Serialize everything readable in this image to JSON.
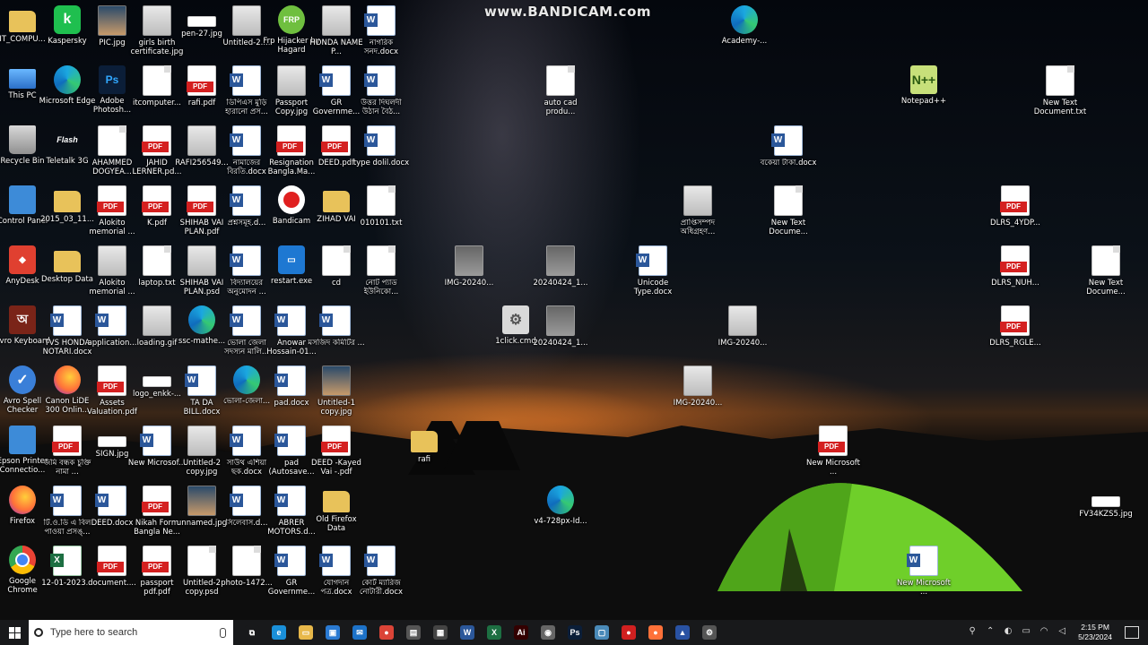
{
  "watermark": "www.BANDICAM.com",
  "desktop": {
    "icons": [
      {
        "label": "IT_COMPU...",
        "type": "folder"
      },
      {
        "label": "Kaspersky",
        "type": "green",
        "glyph": "k"
      },
      {
        "label": "PIC.jpg",
        "type": "photo"
      },
      {
        "label": "girls birth certificate.jpg",
        "type": "img"
      },
      {
        "label": "pen-27.jpg",
        "type": "white"
      },
      {
        "label": "Untitled-2....",
        "type": "img"
      },
      {
        "label": "Frp Hijacker by Hagard",
        "type": "frp",
        "glyph": "FRP"
      },
      {
        "label": "HONDA NAME P...",
        "type": "img"
      },
      {
        "label": "নাগরিক সনদ.docx",
        "type": "word"
      },
      {
        "label": "Academy-...",
        "type": "edge"
      },
      {
        "label": "This PC",
        "type": "pc"
      },
      {
        "label": "Microsoft Edge",
        "type": "edge"
      },
      {
        "label": "Adobe Photosh...",
        "type": "ps",
        "glyph": "Ps"
      },
      {
        "label": "itcomputer...",
        "type": "doc"
      },
      {
        "label": "rafi.pdf",
        "type": "pdf"
      },
      {
        "label": "ডিপিএস মুড়ি হারানো প্রস...",
        "type": "word"
      },
      {
        "label": "Passport Copy.jpg",
        "type": "img"
      },
      {
        "label": "GR Governme...",
        "type": "word"
      },
      {
        "label": "উত্তর দিঘলদী উঠান বৈঠ...",
        "type": "word"
      },
      {
        "label": "auto cad produ...",
        "type": "doc"
      },
      {
        "label": "Notepad++",
        "type": "np",
        "glyph": "N++"
      },
      {
        "label": "New Text Document.txt",
        "type": "doc"
      },
      {
        "label": "Recycle Bin",
        "type": "bin"
      },
      {
        "label": "Teletalk 3G",
        "type": "flash",
        "glyph": "Flash"
      },
      {
        "label": "AHAMMED DOGYEA...",
        "type": "doc"
      },
      {
        "label": "JAHID LERNER.pd...",
        "type": "pdf"
      },
      {
        "label": "RAFI256549...",
        "type": "img"
      },
      {
        "label": "নামাজের বিরতি.docx",
        "type": "word"
      },
      {
        "label": "Resignation Bangla.Ma...",
        "type": "pdf"
      },
      {
        "label": "DEED.pdf",
        "type": "pdf"
      },
      {
        "label": "type dolil.docx",
        "type": "word"
      },
      {
        "label": "বকেয়া টাকা.docx",
        "type": "word"
      },
      {
        "label": "Control Panel",
        "type": "cpanel"
      },
      {
        "label": "2015_03_11...",
        "type": "folder"
      },
      {
        "label": "Alokito memorial ...",
        "type": "pdf"
      },
      {
        "label": "K.pdf",
        "type": "pdf"
      },
      {
        "label": "SHIHAB VAI PLAN.pdf",
        "type": "pdf"
      },
      {
        "label": "প্রশ্নসমূহ.d...",
        "type": "word"
      },
      {
        "label": "Bandicam",
        "type": "rec"
      },
      {
        "label": "ZIHAD VAI",
        "type": "folder"
      },
      {
        "label": "010101.txt",
        "type": "doc"
      },
      {
        "label": "প্রাপ্তিসম্পদ অধিগ্রহণ...",
        "type": "img"
      },
      {
        "label": "New Text Docume...",
        "type": "doc"
      },
      {
        "label": "DLRS_4YDP...",
        "type": "pdf"
      },
      {
        "label": "AnyDesk",
        "type": "red",
        "glyph": "◆"
      },
      {
        "label": "Desktop Data",
        "type": "folder"
      },
      {
        "label": "Alokito memorial ...",
        "type": "img"
      },
      {
        "label": "laptop.txt",
        "type": "doc"
      },
      {
        "label": "SHIHAB VAI PLAN.psd",
        "type": "img"
      },
      {
        "label": "বিদ্যালয়ের অনুমোদন ...",
        "type": "word"
      },
      {
        "label": "restart.exe",
        "type": "blue",
        "glyph": "▭"
      },
      {
        "label": "cd",
        "type": "doc"
      },
      {
        "label": "নোট প্যাড ইউনিকো...",
        "type": "doc"
      },
      {
        "label": "IMG-20240...",
        "type": "imgdark"
      },
      {
        "label": "20240424_1...",
        "type": "imgdark"
      },
      {
        "label": "Unicode Type.docx",
        "type": "word"
      },
      {
        "label": "DLRS_NUH...",
        "type": "pdf"
      },
      {
        "label": "New Text Docume...",
        "type": "doc"
      },
      {
        "label": "Avro Keyboard",
        "type": "avro",
        "glyph": "অ"
      },
      {
        "label": "TVS HONDA NOTARI.docx",
        "type": "word"
      },
      {
        "label": "application...",
        "type": "word"
      },
      {
        "label": "loading.gif",
        "type": "img"
      },
      {
        "label": "ssc-mathe...",
        "type": "edge"
      },
      {
        "label": "ভোলা জেলা সদস্যন মালি...",
        "type": "word"
      },
      {
        "label": "Anowar Hossain-01...",
        "type": "word"
      },
      {
        "label": "মসজিদ কমিটির ...",
        "type": "word"
      },
      {
        "label": "1click.cmd",
        "type": "gear",
        "glyph": "⚙"
      },
      {
        "label": "20240424_1...",
        "type": "imgdark"
      },
      {
        "label": "IMG-20240...",
        "type": "img"
      },
      {
        "label": "DLRS_RGLE...",
        "type": "pdf"
      },
      {
        "label": "Avro Spell Checker",
        "type": "spell",
        "glyph": "✓"
      },
      {
        "label": "Canon LiDE 300 Onlin...",
        "type": "firefox"
      },
      {
        "label": "Assets Valuation.pdf",
        "type": "pdf"
      },
      {
        "label": "logo_enkk-...",
        "type": "white"
      },
      {
        "label": "TA DA BILL.docx",
        "type": "word"
      },
      {
        "label": "ভোলা-জেলা...",
        "type": "edge"
      },
      {
        "label": "pad.docx",
        "type": "word"
      },
      {
        "label": "Untitled-1 copy.jpg",
        "type": "photo"
      },
      {
        "label": "IMG-20240...",
        "type": "img"
      },
      {
        "label": "Epson Printer Connectio...",
        "type": "cpanel"
      },
      {
        "label": "জমি বন্ধক চুক্তি নামা ...",
        "type": "pdf"
      },
      {
        "label": "SIGN.jpg",
        "type": "white"
      },
      {
        "label": "New Microsof...",
        "type": "word"
      },
      {
        "label": "Untitled-2 copy.jpg",
        "type": "img"
      },
      {
        "label": "সাউথ এশিয়া ছক.docx",
        "type": "word"
      },
      {
        "label": "pad (Autosave...",
        "type": "word"
      },
      {
        "label": "DEED -Kayed Vai -.pdf",
        "type": "pdf"
      },
      {
        "label": "rafi",
        "type": "folder"
      },
      {
        "label": "New Microsoft ...",
        "type": "pdf"
      },
      {
        "label": "Firefox",
        "type": "firefox"
      },
      {
        "label": "টি.ও.ডি এ বিল পাওয়া প্রসঙ্...",
        "type": "word"
      },
      {
        "label": "DEED.docx",
        "type": "word"
      },
      {
        "label": "Nikah Form Bangla Ne...",
        "type": "pdf"
      },
      {
        "label": "unnamed.jpg",
        "type": "photo"
      },
      {
        "label": "সিলেবাস.d...",
        "type": "word"
      },
      {
        "label": "ABRER MOTORS.d...",
        "type": "word"
      },
      {
        "label": "Old Firefox Data",
        "type": "folder"
      },
      {
        "label": "v4-728px-Id...",
        "type": "edge"
      },
      {
        "label": "FV34KZS5.jpg",
        "type": "white"
      },
      {
        "label": "Google Chrome",
        "type": "chrome"
      },
      {
        "label": "12-01-2023...",
        "type": "excel"
      },
      {
        "label": "document....",
        "type": "pdf"
      },
      {
        "label": "passport pdf.pdf",
        "type": "pdf"
      },
      {
        "label": "Untitled-2 copy.psd",
        "type": "doc"
      },
      {
        "label": "photo-1472...",
        "type": "doc"
      },
      {
        "label": "GR Governme...",
        "type": "word"
      },
      {
        "label": "যোগদান পত্র.docx",
        "type": "word"
      },
      {
        "label": "কোর্ট ম্যারিজ নোটারী.docx",
        "type": "word"
      },
      {
        "label": "New Microsoft ...",
        "type": "word"
      }
    ]
  },
  "taskbar": {
    "search_placeholder": "Type here to search",
    "apps": [
      {
        "name": "task-view",
        "glyph": "⧉",
        "color": "#18191b"
      },
      {
        "name": "edge",
        "glyph": "e",
        "color": "#1a8fd8"
      },
      {
        "name": "file-explorer",
        "glyph": "▭",
        "color": "#e8b84a"
      },
      {
        "name": "store",
        "glyph": "▣",
        "color": "#2a7ad2"
      },
      {
        "name": "mail",
        "glyph": "✉",
        "color": "#1d72c8"
      },
      {
        "name": "chrome",
        "glyph": "●",
        "color": "#db4437"
      },
      {
        "name": "network",
        "glyph": "▤",
        "color": "#555555"
      },
      {
        "name": "calculator",
        "glyph": "▦",
        "color": "#444444"
      },
      {
        "name": "word",
        "glyph": "W",
        "color": "#2b579a"
      },
      {
        "name": "excel",
        "glyph": "X",
        "color": "#1d6f42"
      },
      {
        "name": "illustrator",
        "glyph": "Ai",
        "color": "#330000"
      },
      {
        "name": "disk",
        "glyph": "◉",
        "color": "#666666"
      },
      {
        "name": "photoshop",
        "glyph": "Ps",
        "color": "#0b1e38"
      },
      {
        "name": "notepad",
        "glyph": "▢",
        "color": "#4a8ab8"
      },
      {
        "name": "bandicam",
        "glyph": "●",
        "color": "#d02020"
      },
      {
        "name": "firefox",
        "glyph": "●",
        "color": "#ff7139"
      },
      {
        "name": "app-blue",
        "glyph": "▲",
        "color": "#2952a3"
      },
      {
        "name": "app-gear",
        "glyph": "⚙",
        "color": "#555555"
      }
    ],
    "time": "2:15 PM",
    "date": "5/23/2024"
  }
}
